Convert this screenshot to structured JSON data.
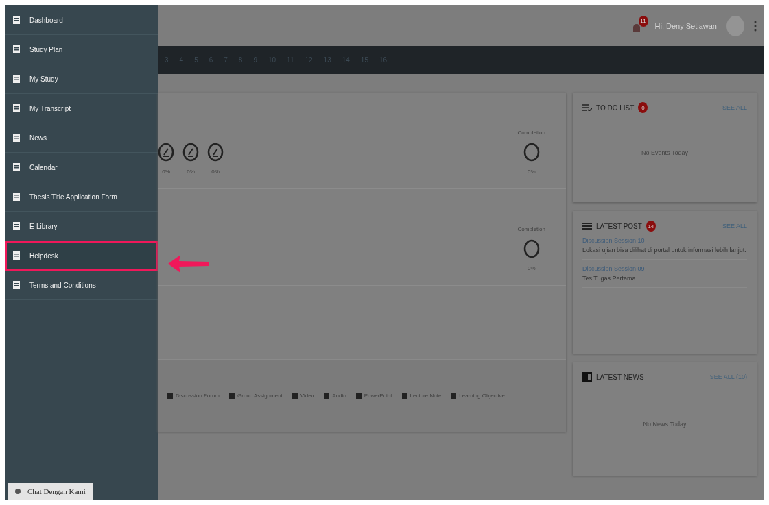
{
  "sidebar": {
    "items": [
      {
        "label": "Dashboard",
        "selected": false
      },
      {
        "label": "Study Plan",
        "selected": false
      },
      {
        "label": "My Study",
        "selected": false
      },
      {
        "label": "My Transcript",
        "selected": false
      },
      {
        "label": "News",
        "selected": false
      },
      {
        "label": "Calendar",
        "selected": false
      },
      {
        "label": "Thesis Title Application Form",
        "selected": false
      },
      {
        "label": "E-Library",
        "selected": false
      },
      {
        "label": "Helpdesk",
        "selected": true
      },
      {
        "label": "Terms and Conditions",
        "selected": false
      }
    ],
    "chat_button": "Chat Dengan Kami"
  },
  "header": {
    "notification_count": "11",
    "greeting": "Hi, Deny Setiawan"
  },
  "week_bar": [
    "3",
    "4",
    "5",
    "6",
    "7",
    "8",
    "9",
    "10",
    "11",
    "12",
    "13",
    "14",
    "15",
    "16"
  ],
  "courses": [
    {
      "progress": [
        "0%",
        "0%",
        "0%"
      ],
      "completion_label": "Completion",
      "completion": "0%"
    },
    {
      "completion_label": "Completion",
      "completion": "0%"
    }
  ],
  "legend": [
    "Discussion Forum",
    "Group Assignment",
    "Video",
    "Audio",
    "PowerPoint",
    "Lecture Note",
    "Learning Objective"
  ],
  "todo": {
    "title": "TO DO LIST",
    "count": "0",
    "link": "SEE ALL",
    "empty": "No Events Today"
  },
  "latest_post": {
    "title": "LATEST POST",
    "count": "14",
    "link": "SEE ALL",
    "posts": [
      {
        "title": "Discussion Session 10",
        "excerpt": "Lokasi ujian bisa dilihat di portal untuk informasi lebih lanjut."
      },
      {
        "title": "Discussion Session 09",
        "excerpt": "Tes Tugas Pertama"
      }
    ]
  },
  "latest_news": {
    "title": "LATEST NEWS",
    "link": "SEE ALL (10)",
    "empty": "No News Today"
  }
}
